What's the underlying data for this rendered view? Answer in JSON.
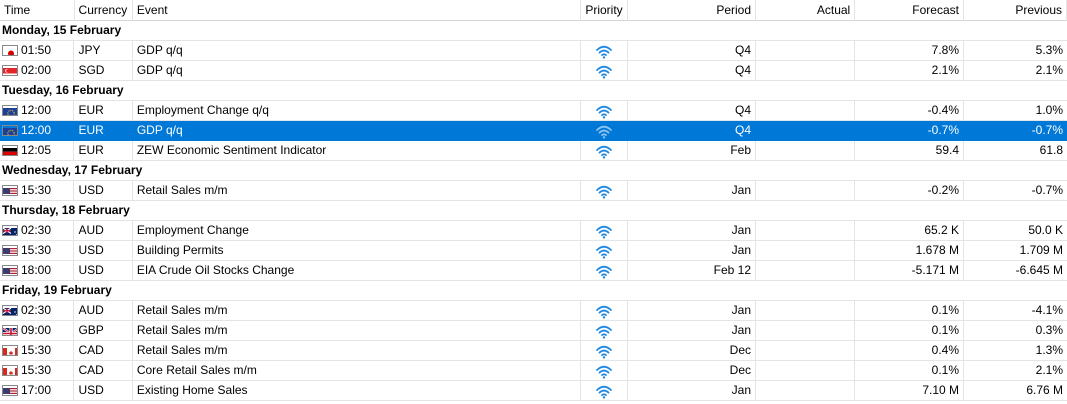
{
  "columns": {
    "time": "Time",
    "currency": "Currency",
    "event": "Event",
    "priority": "Priority",
    "period": "Period",
    "actual": "Actual",
    "forecast": "Forecast",
    "previous": "Previous"
  },
  "groups": [
    {
      "title": "Monday, 15 February",
      "rows": [
        {
          "flag": "jp-flag-icon",
          "time": "01:50",
          "currency": "JPY",
          "event": "GDP q/q",
          "priority": "wifi-icon",
          "period": "Q4",
          "actual": "",
          "forecast": "7.8%",
          "previous": "5.3%"
        },
        {
          "flag": "sg-flag-icon",
          "time": "02:00",
          "currency": "SGD",
          "event": "GDP q/q",
          "priority": "wifi-icon",
          "period": "Q4",
          "actual": "",
          "forecast": "2.1%",
          "previous": "2.1%"
        }
      ]
    },
    {
      "title": "Tuesday, 16 February",
      "rows": [
        {
          "flag": "eu-flag-icon",
          "time": "12:00",
          "currency": "EUR",
          "event": "Employment Change q/q",
          "priority": "wifi-icon",
          "period": "Q4",
          "actual": "",
          "forecast": "-0.4%",
          "previous": "1.0%"
        },
        {
          "flag": "eu-flag-icon",
          "time": "12:00",
          "currency": "EUR",
          "event": "GDP q/q",
          "priority": "wifi-icon",
          "period": "Q4",
          "actual": "",
          "forecast": "-0.7%",
          "previous": "-0.7%",
          "selected": true
        },
        {
          "flag": "de-flag-icon",
          "time": "12:05",
          "currency": "EUR",
          "event": "ZEW Economic Sentiment Indicator",
          "priority": "wifi-icon",
          "period": "Feb",
          "actual": "",
          "forecast": "59.4",
          "previous": "61.8"
        }
      ]
    },
    {
      "title": "Wednesday, 17 February",
      "rows": [
        {
          "flag": "us-flag-icon",
          "time": "15:30",
          "currency": "USD",
          "event": "Retail Sales m/m",
          "priority": "wifi-icon",
          "period": "Jan",
          "actual": "",
          "forecast": "-0.2%",
          "previous": "-0.7%"
        }
      ]
    },
    {
      "title": "Thursday, 18 February",
      "rows": [
        {
          "flag": "au-flag-icon",
          "time": "02:30",
          "currency": "AUD",
          "event": "Employment Change",
          "priority": "wifi-icon",
          "period": "Jan",
          "actual": "",
          "forecast": "65.2 K",
          "previous": "50.0 K"
        },
        {
          "flag": "us-flag-icon",
          "time": "15:30",
          "currency": "USD",
          "event": "Building Permits",
          "priority": "wifi-icon",
          "period": "Jan",
          "actual": "",
          "forecast": "1.678 M",
          "previous": "1.709 M"
        },
        {
          "flag": "us-flag-icon",
          "time": "18:00",
          "currency": "USD",
          "event": "EIA Crude Oil Stocks Change",
          "priority": "wifi-icon",
          "period": "Feb 12",
          "actual": "",
          "forecast": "-5.171 M",
          "previous": "-6.645 M"
        }
      ]
    },
    {
      "title": "Friday, 19 February",
      "rows": [
        {
          "flag": "au-flag-icon",
          "time": "02:30",
          "currency": "AUD",
          "event": "Retail Sales m/m",
          "priority": "wifi-icon",
          "period": "Jan",
          "actual": "",
          "forecast": "0.1%",
          "previous": "-4.1%"
        },
        {
          "flag": "gb-flag-icon",
          "time": "09:00",
          "currency": "GBP",
          "event": "Retail Sales m/m",
          "priority": "wifi-icon",
          "period": "Jan",
          "actual": "",
          "forecast": "0.1%",
          "previous": "0.3%"
        },
        {
          "flag": "ca-flag-icon",
          "time": "15:30",
          "currency": "CAD",
          "event": "Retail Sales m/m",
          "priority": "wifi-icon",
          "period": "Dec",
          "actual": "",
          "forecast": "0.4%",
          "previous": "1.3%"
        },
        {
          "flag": "ca-flag-icon",
          "time": "15:30",
          "currency": "CAD",
          "event": "Core Retail Sales m/m",
          "priority": "wifi-icon",
          "period": "Dec",
          "actual": "",
          "forecast": "0.1%",
          "previous": "2.1%"
        },
        {
          "flag": "us-flag-icon",
          "time": "17:00",
          "currency": "USD",
          "event": "Existing Home Sales",
          "priority": "wifi-icon",
          "period": "Jan",
          "actual": "",
          "forecast": "7.10 M",
          "previous": "6.76 M"
        }
      ]
    }
  ],
  "colors": {
    "selection": "#0078d7",
    "priority_icon": "#1e88e5",
    "grid": "#e4e4e4"
  }
}
